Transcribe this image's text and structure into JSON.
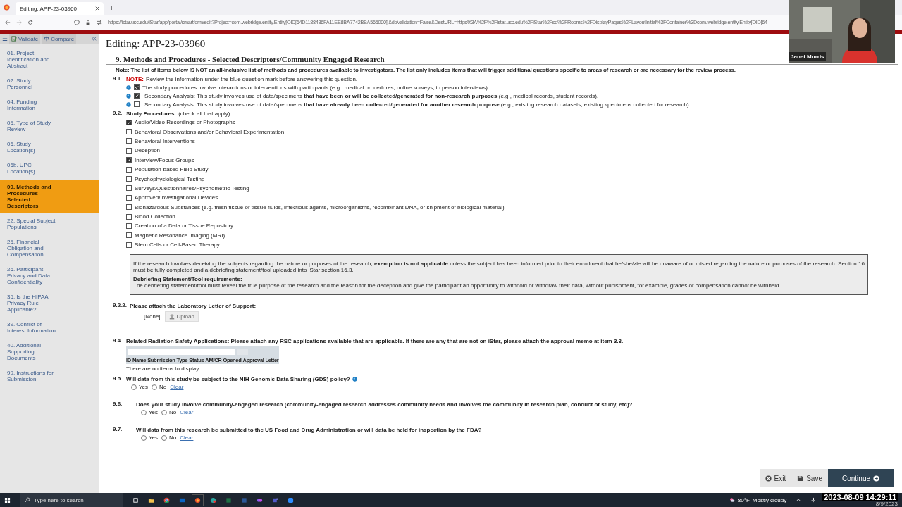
{
  "browser": {
    "tab_title": "Editing: APP-23-03960",
    "new_tab": "+",
    "url": "https://istar.usc.edu/iStar/app/portal/smartform/edit?Project=com.webridge.entity.Entity[OID[64D1188436FA11EE8BA7742BBA565000]]&doValidation=False&DestURL=https%3A%2F%2Fistar.usc.edu%2FiStar%2Fsd%2FRooms%2FDisplayPages%2FLayoutInitial%3FContainer%3Dcom.webridge.entity.Entity[OID[64"
  },
  "toolbar": {
    "validate": "Validate",
    "compare": "Compare"
  },
  "sidebar": {
    "items": [
      {
        "label": "01. Project Identification and Abstract",
        "selected": false
      },
      {
        "label": "02. Study Personnel",
        "selected": false
      },
      {
        "label": "04. Funding Information",
        "selected": false
      },
      {
        "label": "05. Type of Study Review",
        "selected": false
      },
      {
        "label": "06. Study Location(s)",
        "selected": false
      },
      {
        "label": "06b. UPC Location(s)",
        "selected": false
      },
      {
        "label": "09. Methods and Procedures - Selected Descriptors",
        "selected": true
      },
      {
        "label": "22. Special Subject Populations",
        "selected": false
      },
      {
        "label": "25. Financial Obligation and Compensation",
        "selected": false
      },
      {
        "label": "26. Participant Privacy and Data Confidentiality",
        "selected": false
      },
      {
        "label": "35. Is the HIPAA Privacy Rule Applicable?",
        "selected": false
      },
      {
        "label": "39. Conflict of Interest Information",
        "selected": false
      },
      {
        "label": "40. Additional Supporting Documents",
        "selected": false
      },
      {
        "label": "99. Instructions for Submission",
        "selected": false
      }
    ]
  },
  "page": {
    "title": "Editing: APP-23-03960",
    "section_title": "9. Methods and Procedures - Selected Descriptors/Community Engaged Research",
    "note": "Note: The list of items below IS NOT an all-inclusive list of methods and procedures available to investigators. The list only includes items that will trigger additional questions specific to areas of research or are necessary for the review process."
  },
  "q91": {
    "number": "9.1.",
    "note_label": "NOTE:",
    "note_text": "Review the information under the blue question mark before answering this question.",
    "options": [
      {
        "text": "The study procedures involve interactions or interventions with participants (e.g., medical procedures, online surveys, in person interviews).",
        "checked": true
      },
      {
        "text": "Secondary Analysis: This study involves use of data/specimens **that have been or will be collected/generated for non-research purposes** (e.g., medical records, student records).",
        "checked": true
      },
      {
        "text": "Secondary Analysis: This study involves use of data/specimens **that have already been collected/generated for another research purpose** (e.g., existing research datasets, existing specimens collected for research).",
        "checked": false
      }
    ]
  },
  "q92": {
    "number": "9.2.",
    "label": "Study Procedures:",
    "hint": "(check all that apply)",
    "options": [
      {
        "text": "Audio/Video Recordings or Photographs",
        "checked": true
      },
      {
        "text": "Behavioral Observations and/or Behavioral Experimentation",
        "checked": false
      },
      {
        "text": "Behavioral Interventions",
        "checked": false
      },
      {
        "text": "Deception",
        "checked": false
      },
      {
        "text": "Interview/Focus Groups",
        "checked": true
      },
      {
        "text": "Population-based Field Study",
        "checked": false
      },
      {
        "text": "Psychophysiological Testing",
        "checked": false
      },
      {
        "text": "Surveys/Questionnaires/Psychometric Testing",
        "checked": false
      },
      {
        "text": "Approved/Investigational Devices",
        "checked": false
      },
      {
        "text": "Biohazardous Substances (e.g. fresh tissue or tissue fluids, infectious agents, microorganisms, recombinant DNA, or shipment of biological material)",
        "checked": false
      },
      {
        "text": "Blood Collection",
        "checked": false
      },
      {
        "text": "Creation of a Data or Tissue Repository",
        "checked": false
      },
      {
        "text": "Magnetic Resonance Imaging (MRI)",
        "checked": false
      },
      {
        "text": "Stem Cells or Cell-Based Therapy",
        "checked": false
      }
    ]
  },
  "info_box": {
    "text": "If the research involves deceiving the subjects regarding the nature or purposes of the research, **exemption is not applicable** unless the subject has been informed prior to their enrollment that he/she/zie will be unaware of or misled regarding the nature or purposes of the research. Section 16 must be fully completed and a debriefing statement/tool uploaded into iStar section 16.3.",
    "heading": "Debriefing Statement/Tool requirements:",
    "body": "The debriefing statement/tool must reveal the true purpose of the research and the reason for the deception and give the participant an opportunity to withhold or withdraw their data, without punishment, for example, grades or compensation cannot be withheld."
  },
  "q922": {
    "number": "9.2.2.",
    "label": "Please attach the Laboratory Letter of Support:",
    "value": "[None]",
    "upload": "Upload"
  },
  "q94": {
    "number": "9.4.",
    "label": "Related Radiation Safety Applications: Please attach any RSC applications available that are applicable. If there are any that are not on iStar, please attach the approval memo at item 3.3.",
    "lookup": "...",
    "columns": [
      "ID",
      "Name",
      "Submission Type",
      "Status",
      "AM/CR",
      "Opened",
      "Approval Letter"
    ],
    "empty": "There are no items to display"
  },
  "questions": [
    {
      "number": "9.5.",
      "text": "Will data from this study be subject to the NIH Genomic Data Sharing (GDS) policy?",
      "info_icon": true,
      "options": [
        {
          "label": "Yes",
          "selected": false
        },
        {
          "label": "No",
          "selected": false
        }
      ],
      "clear": "Clear"
    },
    {
      "number": "9.6.",
      "text": "Does your study involve community-engaged research (community-engaged research addresses community needs and involves the community in research plan, conduct of study, etc)?",
      "info_icon": false,
      "options": [
        {
          "label": "Yes",
          "selected": false
        },
        {
          "label": "No",
          "selected": false
        }
      ],
      "clear": "Clear"
    },
    {
      "number": "9.7.",
      "text": "Will data from this research be submitted to the US Food and Drug Administration or will data be held for inspection by the FDA?",
      "info_icon": false,
      "options": [
        {
          "label": "Yes",
          "selected": false
        },
        {
          "label": "No",
          "selected": false
        }
      ],
      "clear": "Clear"
    }
  ],
  "footer": [
    {
      "kind": "exit",
      "label": "Exit"
    },
    {
      "kind": "save",
      "label": "Save"
    },
    {
      "kind": "continue",
      "label": "Continue"
    }
  ],
  "webcam": {
    "name": "Janet Morris"
  },
  "taskbar": {
    "search_placeholder": "Type here to search",
    "weather": "80°F",
    "weather_text": "Mostly cloudy",
    "timestamp": "2023-08-09 14:29:11",
    "date": "8/9/2023"
  }
}
